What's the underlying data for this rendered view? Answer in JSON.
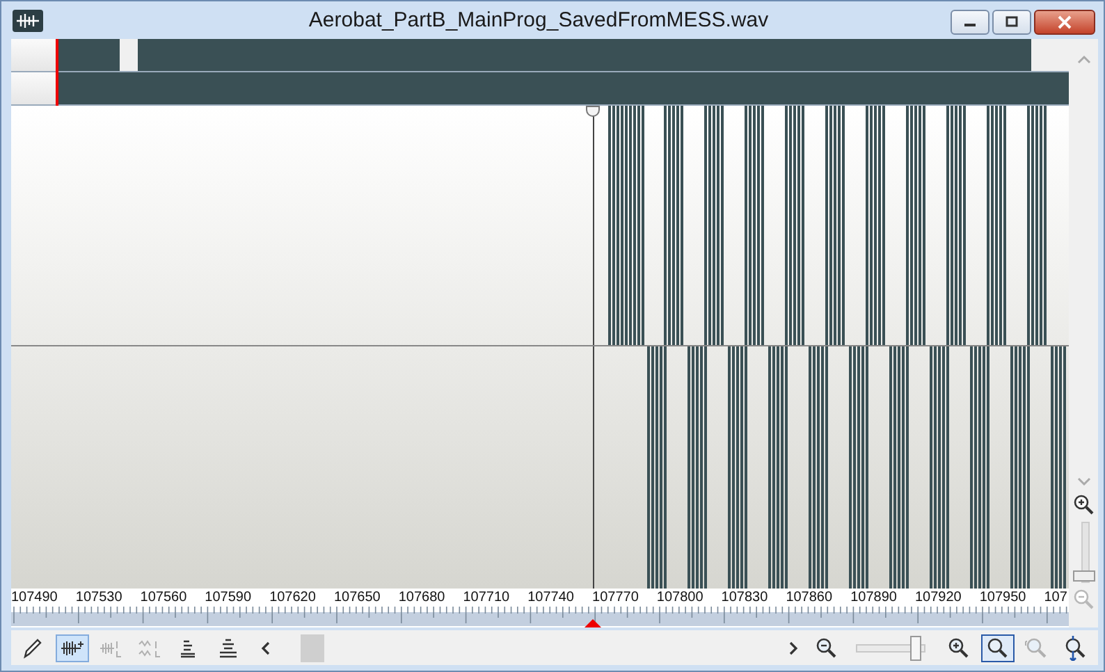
{
  "window": {
    "title": "Aerobat_PartB_MainProg_SavedFromMESS.wav"
  },
  "ruler": {
    "labels": [
      "107490",
      "107530",
      "107560",
      "107590",
      "107620",
      "107650",
      "107680",
      "107710",
      "107740",
      "107770",
      "107800",
      "107830",
      "107860",
      "107890",
      "107920",
      "107950",
      "107"
    ]
  },
  "tools": [
    {
      "kind": "pencil",
      "selected": false,
      "disabled": false
    },
    {
      "kind": "wave",
      "selected": true,
      "disabled": false
    },
    {
      "kind": "wave-lr",
      "selected": false,
      "disabled": true
    },
    {
      "kind": "wave-lr-alt",
      "selected": false,
      "disabled": true
    },
    {
      "kind": "levels",
      "selected": false,
      "disabled": false
    },
    {
      "kind": "levels-alt",
      "selected": false,
      "disabled": false
    }
  ],
  "zoom_slider": {
    "level": 0.92
  },
  "zoom_tools": [
    {
      "kind": "zoom-in",
      "selected": false,
      "disabled": false
    },
    {
      "kind": "zoom-fit",
      "selected": true,
      "disabled": false
    },
    {
      "kind": "zoom-selection",
      "selected": false,
      "disabled": true
    },
    {
      "kind": "zoom-vertical",
      "selected": false,
      "disabled": false
    }
  ],
  "vertical_zoom": {
    "level": 0.05,
    "zoom_out_disabled": true
  }
}
